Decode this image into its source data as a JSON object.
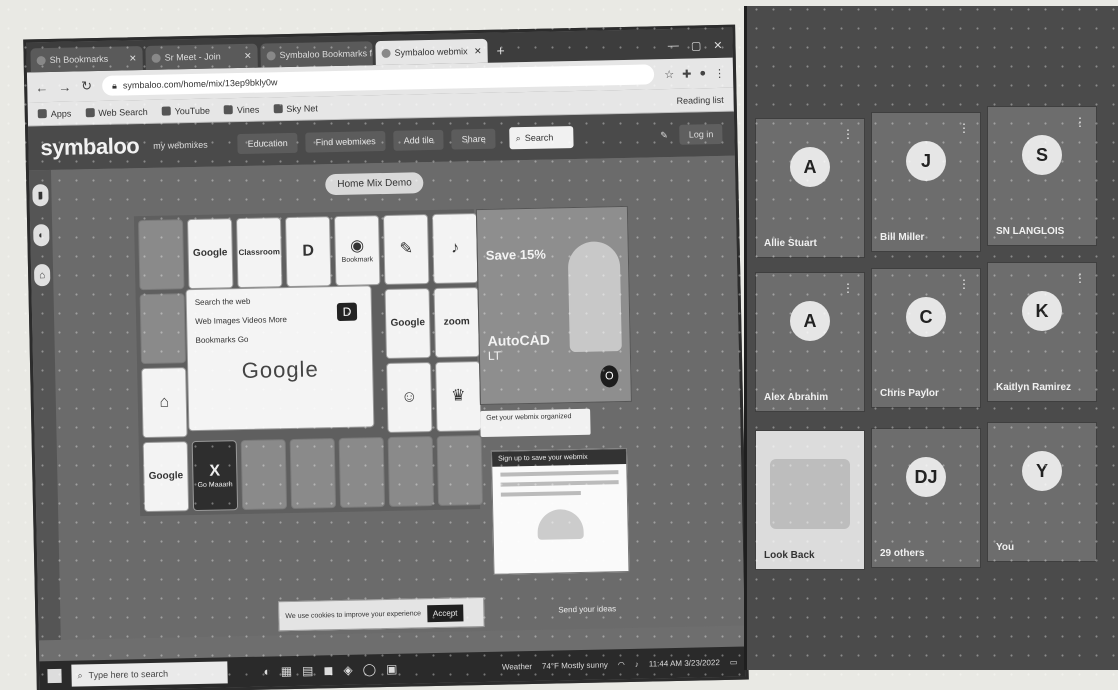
{
  "tabs": [
    {
      "label": "Sh Bookmarks"
    },
    {
      "label": "Sr Meet - Join"
    },
    {
      "label": "Symbaloo Bookmarks for Sch"
    },
    {
      "label": "Symbaloo webmix"
    }
  ],
  "new_tab": "+",
  "window_controls": [
    "—",
    "▢",
    "✕"
  ],
  "address": {
    "url": "symbaloo.com/home/mix/13ep9bkly0w"
  },
  "bookmarks": [
    {
      "label": "Apps"
    },
    {
      "label": "Web Search"
    },
    {
      "label": "YouTube"
    },
    {
      "label": "Vines"
    },
    {
      "label": "Sky Net"
    }
  ],
  "bookmarks_right": "Reading list",
  "symbaloo": {
    "logo": "symbaloo",
    "user": "my webmixes",
    "nav": [
      "Education",
      "Find webmixes",
      "Add tile",
      "Share"
    ],
    "search_label": "Search",
    "login": "Log in",
    "mix_title": "Home  Mix  Demo",
    "tiles": [
      {
        "glyph": "",
        "label": ""
      },
      {
        "glyph": "Google",
        "label": ""
      },
      {
        "glyph": "Classroom",
        "label": ""
      },
      {
        "glyph": "D",
        "label": ""
      },
      {
        "glyph": "◉",
        "label": "Bookmark"
      },
      {
        "glyph": "✎",
        "label": ""
      },
      {
        "glyph": "♪",
        "label": ""
      },
      {
        "glyph": "Google",
        "label": ""
      },
      {
        "glyph": "zoom",
        "label": ""
      },
      {
        "glyph": "⌂",
        "label": ""
      },
      {
        "glyph": "☺",
        "label": ""
      },
      {
        "glyph": "♛",
        "label": ""
      },
      {
        "glyph": "Google",
        "label": ""
      },
      {
        "glyph": "X",
        "label": "Go Maaarh"
      }
    ],
    "center_panel": {
      "line1": "Search the web",
      "line2": "Web   Images   Videos   More",
      "line3": "Bookmarks   Go",
      "logo": "Google",
      "badge": "D"
    },
    "ad": {
      "headline": "Save 15%",
      "product": "AutoCAD",
      "product2": "LT",
      "badge": "O"
    },
    "notice": "Get your webmix organized",
    "info": {
      "head": "Sign up to save your webmix"
    },
    "cookie": {
      "text": "We use cookies to improve your experience",
      "button": "Accept"
    },
    "right_note": "Send your ideas"
  },
  "taskbar": {
    "search_placeholder": "Type here to search",
    "apps": [
      "◐",
      "▦",
      "▤",
      "◼",
      "◈",
      "◯",
      "▣"
    ],
    "weather": "Weather",
    "status": "74°F  Mostly sunny",
    "time": "11:44 AM",
    "date": "3/23/2022"
  },
  "right_tiles": [
    {
      "name": "Allie Stuart",
      "initial": "A",
      "style": "dark"
    },
    {
      "name": "Bill Miller",
      "initial": "J",
      "style": "dark"
    },
    {
      "name": "SN LANGLOIS",
      "initial": "S",
      "style": "dark"
    },
    {
      "name": "Alex Abrahim",
      "initial": "A",
      "style": "dark"
    },
    {
      "name": "Chris Paylor",
      "initial": "C",
      "style": "dark"
    },
    {
      "name": "Kaitlyn Ramirez",
      "initial": "K",
      "style": "dark"
    },
    {
      "name": "Look Back",
      "initial": "",
      "style": "light"
    },
    {
      "name": "29 others",
      "initial": "DJ",
      "style": "dark"
    },
    {
      "name": "You",
      "initial": "Y",
      "style": "dark"
    }
  ]
}
